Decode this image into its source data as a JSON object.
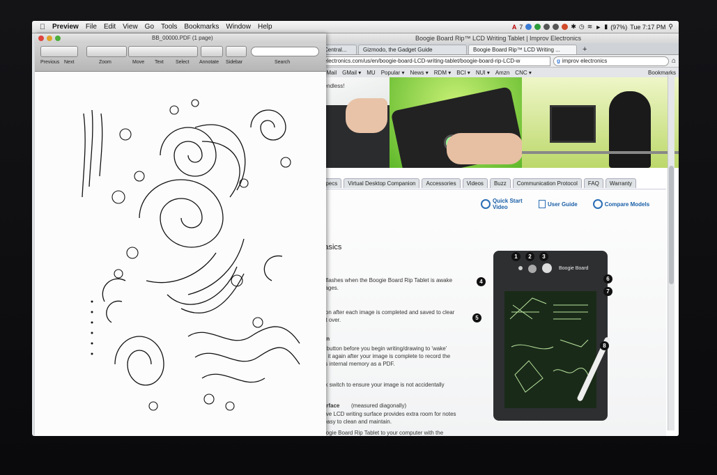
{
  "menubar": {
    "apple": "",
    "app": "Preview",
    "items": [
      "File",
      "Edit",
      "View",
      "Go",
      "Tools",
      "Bookmarks",
      "Window",
      "Help"
    ],
    "battery": "(97%)",
    "clock": "Tue 7:17 PM",
    "adobe": "7"
  },
  "preview": {
    "title": "BB_00000.PDF (1 page)",
    "toolbar": [
      "Previous",
      "Next",
      "Zoom",
      "Move",
      "Text",
      "Select",
      "Annotate",
      "Sidebar",
      "Search"
    ]
  },
  "browser": {
    "title": "Boogie Board Rip™ LCD Writing Tablet | Improv Electronics",
    "tabs": [
      "Central...",
      "Gizmodo, the Gadget Guide",
      "Boogie Board Rip™ LCD Writing ..."
    ],
    "new_tab": "+",
    "url": "electronics.com/us/en/boogie-board-LCD-writing-tablet/boogie-board-rip-LCD-w",
    "search": "improv electronics",
    "bookmarks": [
      "ol Mail",
      "GMail ▾",
      "MU",
      "Popular ▾",
      "News ▾",
      "RDM ▾",
      "BCI ▾",
      "NUI ▾",
      "Amzn",
      "CNC ▾"
    ],
    "bookmarks_menu": "Bookmarks",
    "hero_text": [
      "e endless!"
    ],
    "page_tabs": [
      "Specs",
      "Virtual Desktop Companion",
      "Accessories",
      "Videos",
      "Buzz",
      "Communication Protocol",
      "FAQ",
      "Warranty"
    ],
    "links": [
      "Quick Start Video",
      "User Guide",
      "Compare Models"
    ],
    "heading": "Basics",
    "lines": [
      "or flashes when the Boogie Board Rip Tablet is awake",
      "images.",
      "utton after each image is completed and saved to clear",
      "tart over.",
      "tton",
      "ke button before you begin writing/drawing to 'wake'",
      "ish it again after your image is complete to record the",
      "et's internal memory as a PDF.",
      "ock switch to ensure your image is not accidentally",
      "Surface",
      "(measured diagonally)",
      "sitive LCD writing surface provides extra room for notes",
      "o easy to clean and maintain.",
      "Boogie Board Rip Tablet to your computer with the"
    ],
    "brand": "Boogie Board",
    "callouts": [
      "1",
      "2",
      "3",
      "4",
      "5",
      "6",
      "7",
      "8"
    ]
  }
}
